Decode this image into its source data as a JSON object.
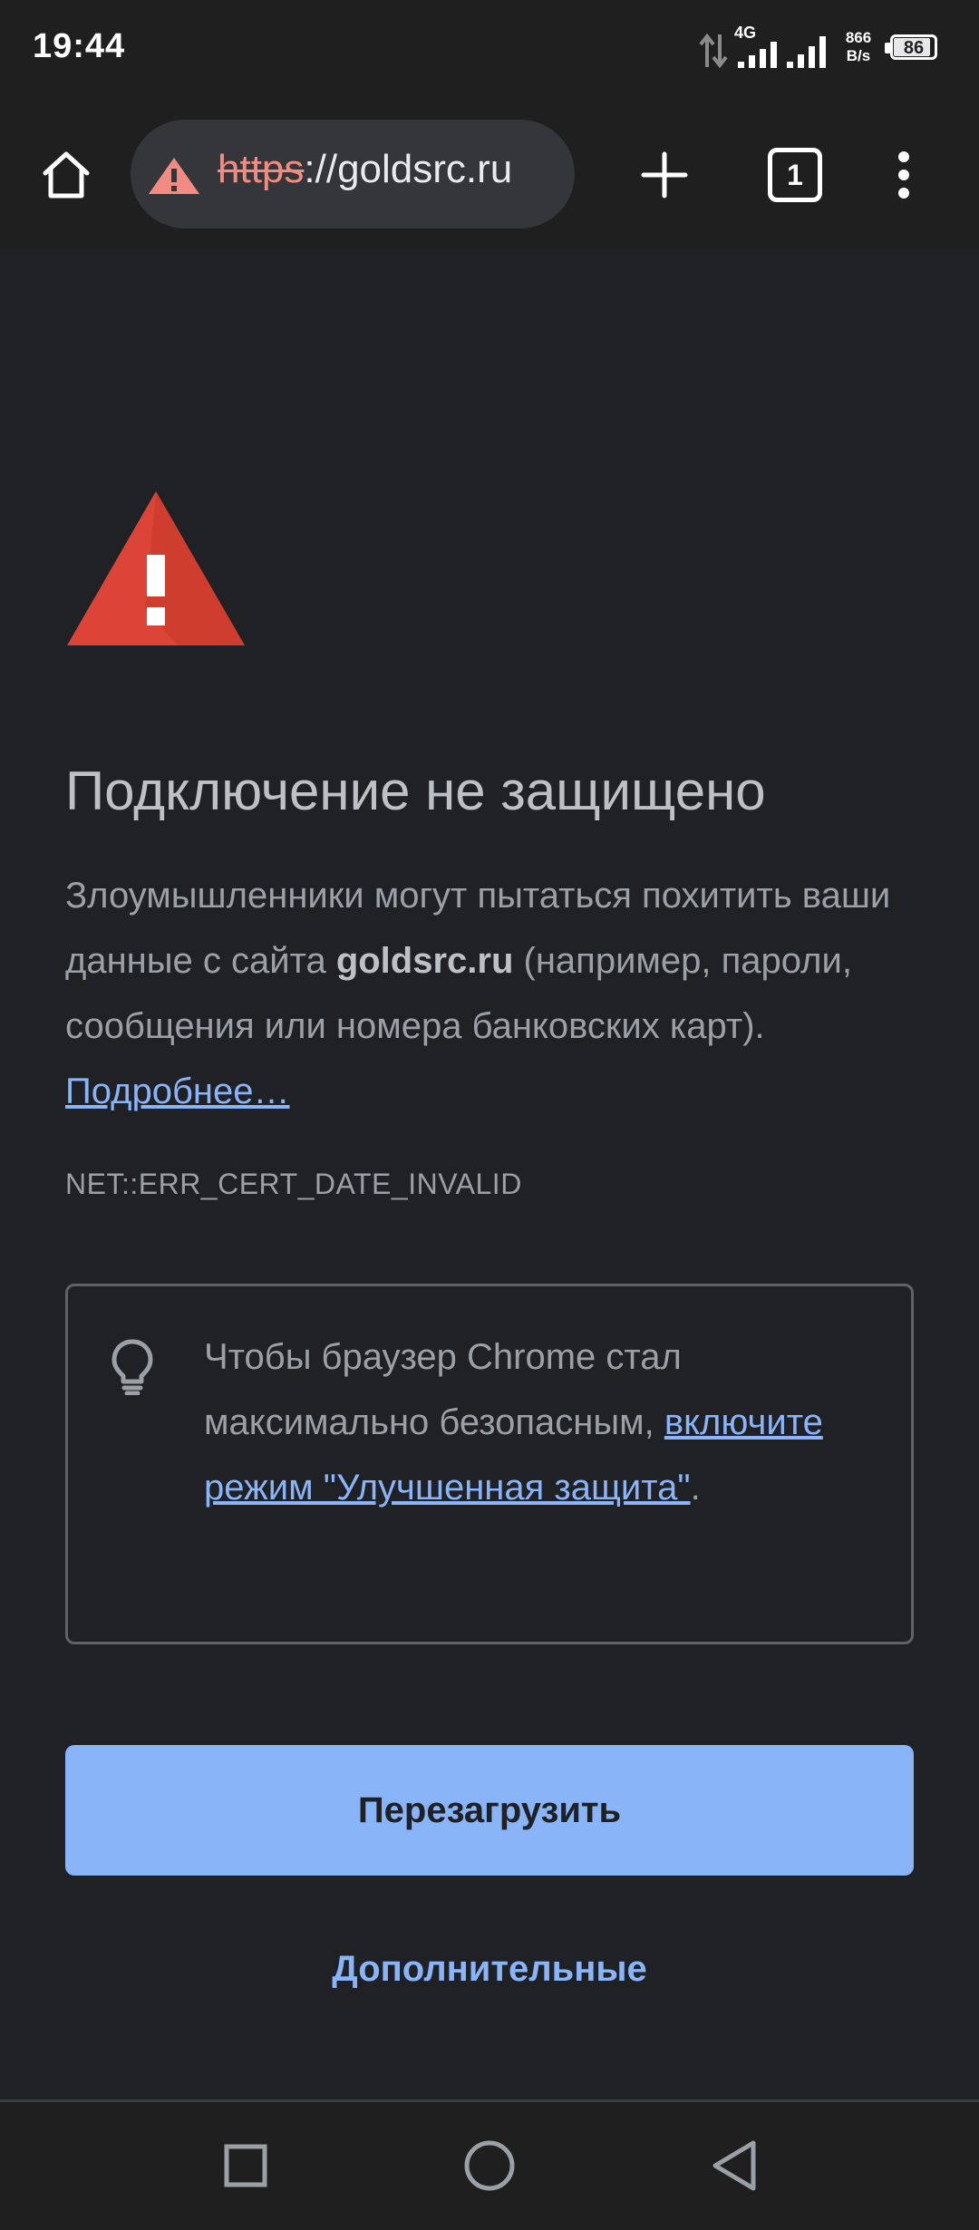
{
  "status_bar": {
    "time": "19:44",
    "network_type": "4G",
    "net_speed_value": "866",
    "net_speed_unit": "B/s",
    "battery_level": "86",
    "icons": [
      "data-transfer-icon",
      "signal-4g-icon",
      "signal-icon",
      "battery-icon"
    ]
  },
  "toolbar": {
    "url_scheme": "https",
    "url_rest": "://goldsrc.ru",
    "tab_count": "1",
    "icons": [
      "home-icon",
      "security-warning-icon",
      "new-tab-icon",
      "tab-switcher-icon",
      "more-vert-icon"
    ]
  },
  "interstitial": {
    "title": "Подключение не защищено",
    "desc_part1": "Злоумышленники могут пытаться похитить ваши данные с сайта ",
    "desc_domain": "goldsrc.ru",
    "desc_part2": " (например, пароли, сообщения или номера банковских карт). ",
    "learn_more_link": "Подробнее…",
    "error_code": "NET::ERR_CERT_DATE_INVALID",
    "tip_text": "Чтобы браузер Chrome стал максимально безопасным, ",
    "tip_link": "включите режим \"Улучшенная защита\"",
    "tip_end": ".",
    "reload_button": "Перезагрузить",
    "advanced_button": "Дополнительные"
  },
  "colors": {
    "background": "#202124",
    "accent": "#8ab4f8",
    "warning_red": "#db4437",
    "insecure_scheme": "#f28b82"
  },
  "nav_bar": {
    "icons": [
      "recents-square-icon",
      "home-circle-icon",
      "back-triangle-icon"
    ]
  }
}
